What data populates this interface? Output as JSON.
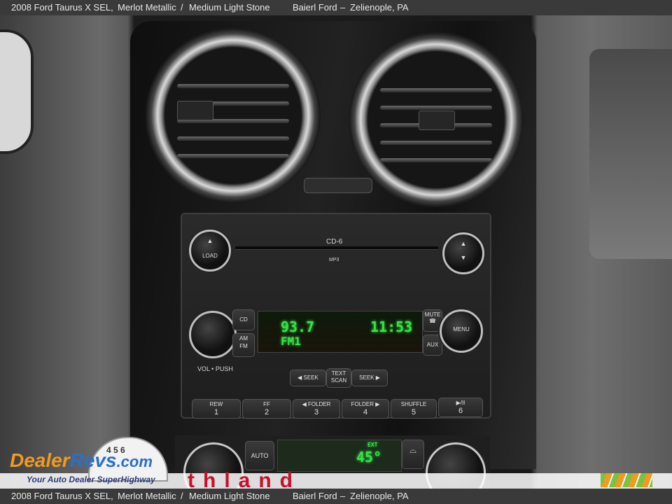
{
  "caption": {
    "vehicle": "2008 Ford Taurus X SEL,",
    "exterior": "Merlot Metallic",
    "separator": "/",
    "interior": "Medium Light Stone",
    "dealer": "Baierl Ford",
    "dash": "–",
    "location": "Zelienople, PA"
  },
  "radio": {
    "cd_label": "CD-6",
    "mp3_label": "MP3",
    "load_label": "LOAD",
    "cd_button": "CD",
    "am_fm_top": "AM",
    "am_fm_bottom": "FM",
    "mute_label": "MUTE",
    "aux_label": "AUX",
    "menu_label": "MENU",
    "vol_push": "VOL • PUSH",
    "seek_left": "◀ SEEK",
    "text_scan_top": "TEXT",
    "text_scan_bottom": "SCAN",
    "seek_right": "SEEK ▶",
    "display": {
      "frequency": "93.7",
      "band": "FM1",
      "clock": "11:53"
    },
    "presets": [
      {
        "label": "REW",
        "num": "1"
      },
      {
        "label": "FF",
        "num": "2"
      },
      {
        "label": "◀ FOLDER",
        "num": "3"
      },
      {
        "label": "FOLDER ▶",
        "num": "4"
      },
      {
        "label": "SHUFFLE",
        "num": "5"
      },
      {
        "label": "▶/II",
        "num": "6"
      }
    ]
  },
  "climate": {
    "auto_label": "AUTO",
    "ext_label": "EXT",
    "ext_temp": "45°"
  },
  "watermark": {
    "brand_prefix": "Dealer",
    "brand_mid": "Revs",
    "brand_suffix": ".com",
    "tagline": "Your Auto Dealer SuperHighway",
    "speedo_digits": "4 5 6",
    "banner_text": "thland"
  },
  "colors": {
    "lcd_green": "#39e14a",
    "brand_orange": "#f29a1f",
    "brand_blue": "#2a6fc9",
    "banner_red": "#c8102e"
  }
}
